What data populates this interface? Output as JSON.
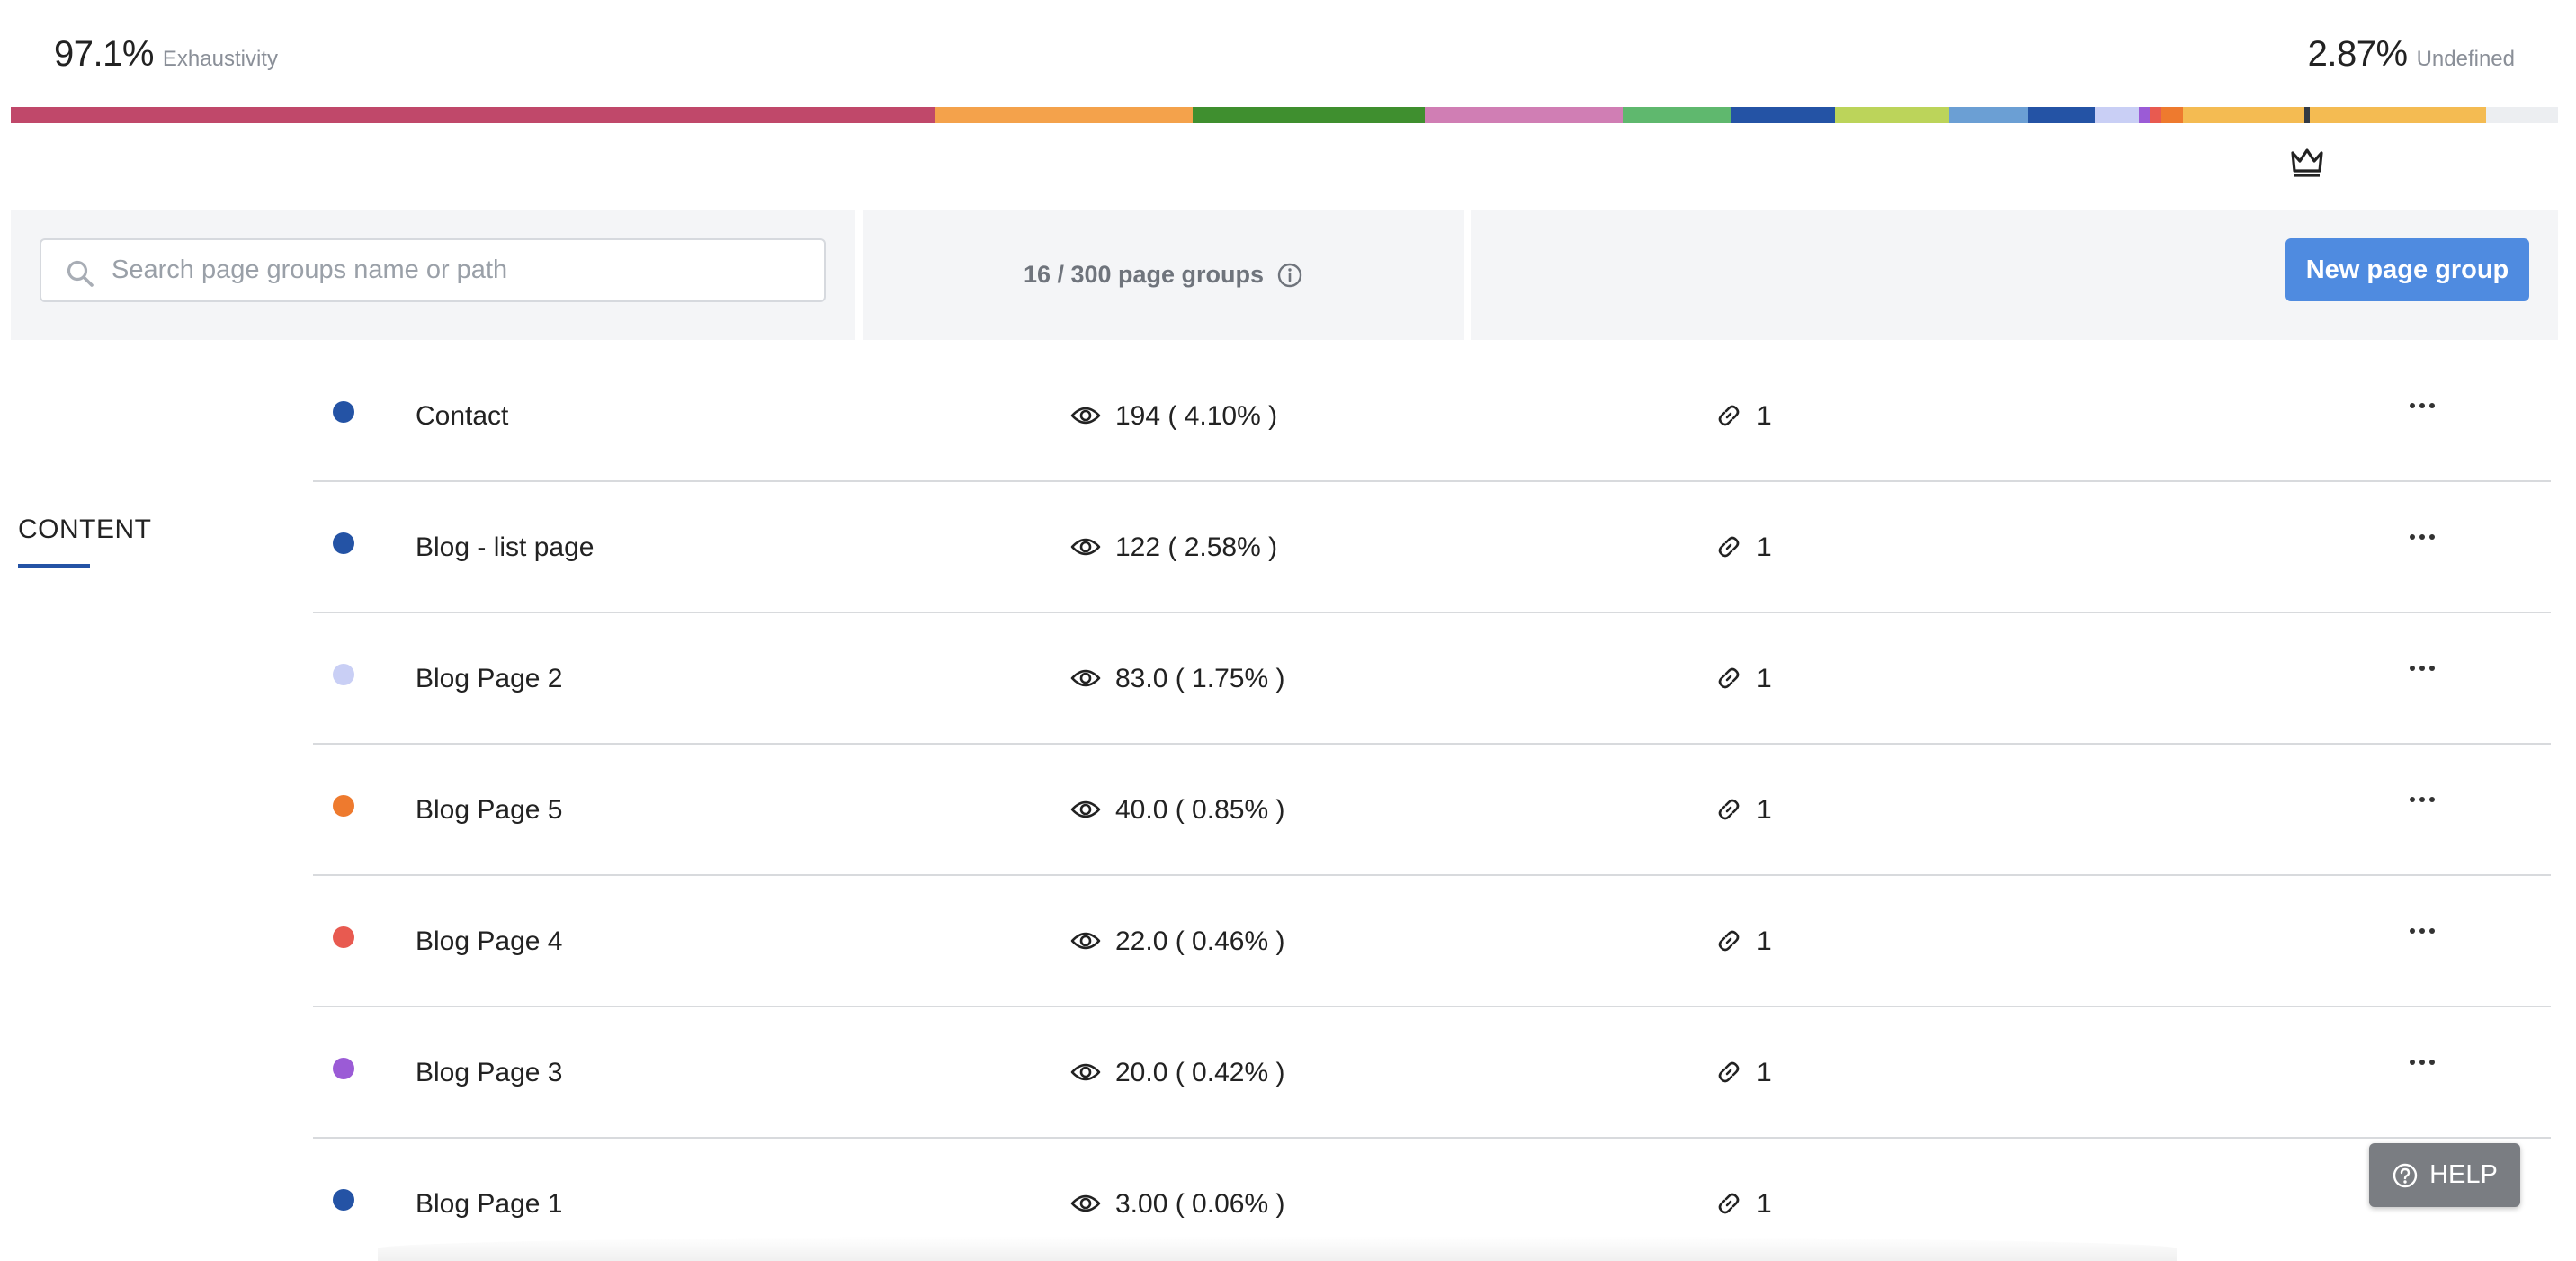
{
  "header": {
    "exhaustivity_value": "97.1%",
    "exhaustivity_label": "Exhaustivity",
    "undefined_value": "2.87%",
    "undefined_label": "Undefined"
  },
  "distribution_bar": [
    {
      "color": "#c0486a",
      "percent": 36.3
    },
    {
      "color": "#f4a24b",
      "percent": 10.1
    },
    {
      "color": "#3f8f2f",
      "percent": 9.1
    },
    {
      "color": "#d07eb4",
      "percent": 7.8
    },
    {
      "color": "#5fb86e",
      "percent": 4.2
    },
    {
      "color": "#2453a5",
      "percent": 4.1
    },
    {
      "color": "#bcd45a",
      "percent": 4.5
    },
    {
      "color": "#6b9fd4",
      "percent": 3.1
    },
    {
      "color": "#2453a5",
      "percent": 2.6
    },
    {
      "color": "#c9cff5",
      "percent": 1.75
    },
    {
      "color": "#9b5bd6",
      "percent": 0.42
    },
    {
      "color": "#e85a50",
      "percent": 0.46
    },
    {
      "color": "#ee7a2e",
      "percent": 0.85
    },
    {
      "color": "#f4bb52",
      "percent": 11.9
    }
  ],
  "toolbar": {
    "search_placeholder": "Search page groups name or path",
    "count_text": "16 / 300 page groups",
    "new_button_label": "New page group"
  },
  "section": {
    "label": "CONTENT"
  },
  "rows": [
    {
      "name": "Contact",
      "color": "#2453a5",
      "views": "194 ( 4.10% )",
      "links": "1"
    },
    {
      "name": "Blog - list page",
      "color": "#2453a5",
      "views": "122 ( 2.58% )",
      "links": "1"
    },
    {
      "name": "Blog Page 2",
      "color": "#c9cff5",
      "views": "83.0 ( 1.75% )",
      "links": "1"
    },
    {
      "name": "Blog Page 5",
      "color": "#ee7a2e",
      "views": "40.0 ( 0.85% )",
      "links": "1"
    },
    {
      "name": "Blog Page 4",
      "color": "#e85a50",
      "views": "22.0 ( 0.46% )",
      "links": "1"
    },
    {
      "name": "Blog Page 3",
      "color": "#9b5bd6",
      "views": "20.0 ( 0.42% )",
      "links": "1"
    },
    {
      "name": "Blog Page 1",
      "color": "#2453a5",
      "views": "3.00 ( 0.06% )",
      "links": "1"
    }
  ],
  "help": {
    "label": "HELP"
  },
  "icons": {
    "search": "search-icon",
    "info": "info-icon",
    "crown": "crown-icon",
    "eye": "eye-icon",
    "link": "link-icon",
    "more": "more-horizontal-icon",
    "help": "question-circle-icon"
  }
}
